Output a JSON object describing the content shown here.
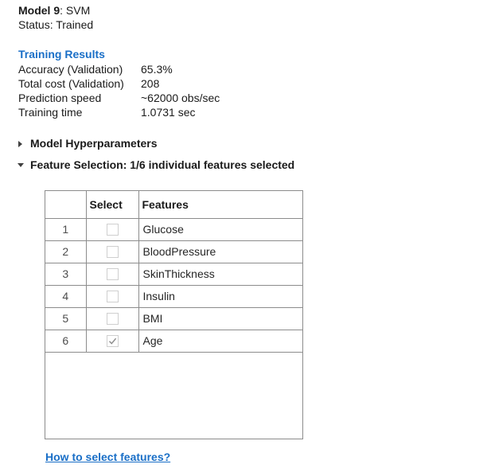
{
  "header": {
    "model_label": "Model 9",
    "model_suffix": ": SVM",
    "status": "Status: Trained"
  },
  "training_results": {
    "title": "Training Results",
    "metrics": [
      {
        "label": "Accuracy (Validation)",
        "value": "65.3%"
      },
      {
        "label": "Total cost (Validation)",
        "value": "208"
      },
      {
        "label": "Prediction speed",
        "value": "~62000 obs/sec"
      },
      {
        "label": "Training time",
        "value": "1.0731 sec"
      }
    ]
  },
  "sections": {
    "hyperparameters": {
      "label": "Model Hyperparameters",
      "expanded": false
    },
    "feature_selection": {
      "label": "Feature Selection: 1/6 individual features selected",
      "expanded": true
    }
  },
  "feature_table": {
    "columns": [
      "Select",
      "Features"
    ],
    "rows": [
      {
        "index": "1",
        "feature": "Glucose",
        "selected": false
      },
      {
        "index": "2",
        "feature": "BloodPressure",
        "selected": false
      },
      {
        "index": "3",
        "feature": "SkinThickness",
        "selected": false
      },
      {
        "index": "4",
        "feature": "Insulin",
        "selected": false
      },
      {
        "index": "5",
        "feature": "BMI",
        "selected": false
      },
      {
        "index": "6",
        "feature": "Age",
        "selected": true
      }
    ]
  },
  "help_link": "How to select features?",
  "colors": {
    "link": "#1a6fc7",
    "border": "#8c8c8c",
    "checkbox_border": "#cfcfcf",
    "checkmark": "#8a8a8a"
  }
}
